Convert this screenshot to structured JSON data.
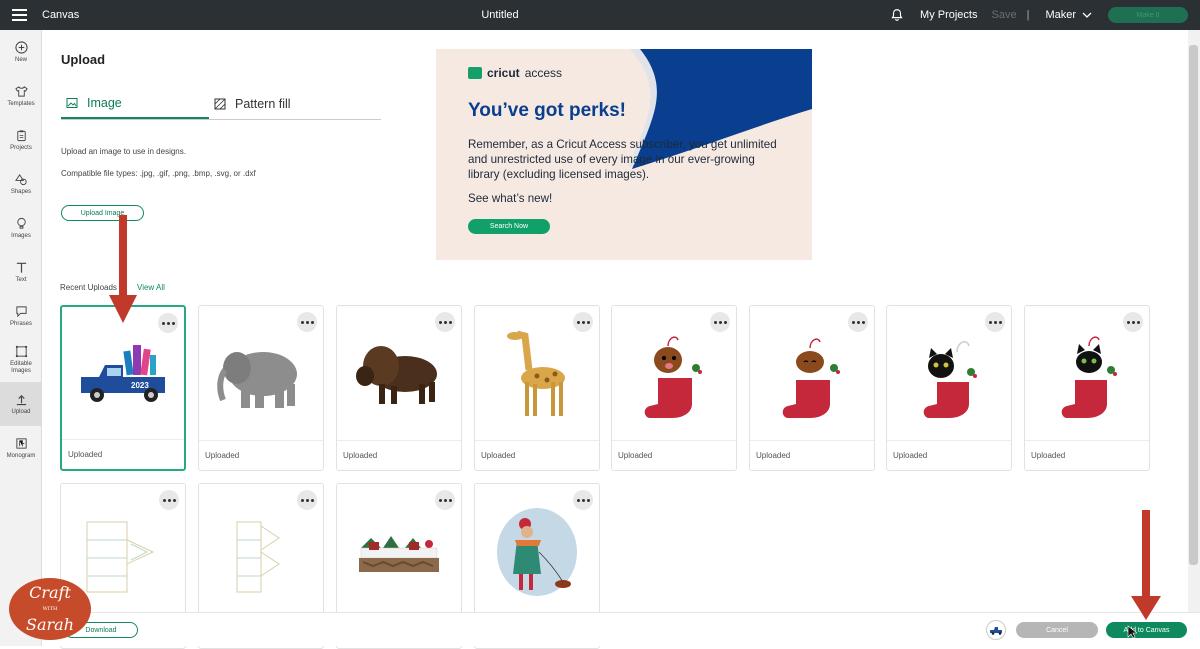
{
  "topbar": {
    "app_name": "Canvas",
    "doc_title": "Untitled",
    "my_projects": "My Projects",
    "save": "Save",
    "separator": "|",
    "machine": "Maker",
    "make_it": "Make It"
  },
  "leftnav": {
    "items": [
      {
        "label": "New",
        "icon": "plus-circle-icon"
      },
      {
        "label": "Templates",
        "icon": "shirt-icon"
      },
      {
        "label": "Projects",
        "icon": "clipboard-icon"
      },
      {
        "label": "Shapes",
        "icon": "shapes-icon"
      },
      {
        "label": "Images",
        "icon": "bulb-icon"
      },
      {
        "label": "Text",
        "icon": "text-icon"
      },
      {
        "label": "Phrases",
        "icon": "speech-bubble-icon"
      },
      {
        "label": "Editable Images",
        "icon": "editable-images-icon"
      },
      {
        "label": "Upload",
        "icon": "upload-icon"
      },
      {
        "label": "Monogram",
        "icon": "monogram-icon"
      }
    ]
  },
  "panel": {
    "title": "Upload",
    "tabs": [
      {
        "label": "Image",
        "active": true
      },
      {
        "label": "Pattern fill",
        "active": false
      }
    ],
    "desc": "Upload an image to use in designs.",
    "file_types": "Compatible file types: .jpg, .gif, .png, .bmp, .svg, or .dxf",
    "upload_button": "Upload Image"
  },
  "banner": {
    "brand": "cricut",
    "brand_suffix": "access",
    "heading": "You’ve got perks!",
    "body": "Remember, as a Cricut Access subscriber, you get unlimited and unrestricted use of every image in our ever-growing library (excluding licensed images).",
    "sub": "See what’s new!",
    "button": "Search Now"
  },
  "recent": {
    "label": "Recent Uploads",
    "view_all": "View All",
    "cards": [
      {
        "caption": "Uploaded",
        "image": "blue-truck-2023",
        "selected": true
      },
      {
        "caption": "Uploaded",
        "image": "elephant"
      },
      {
        "caption": "Uploaded",
        "image": "bison"
      },
      {
        "caption": "Uploaded",
        "image": "giraffe"
      },
      {
        "caption": "Uploaded",
        "image": "dog-stocking"
      },
      {
        "caption": "Uploaded",
        "image": "dog-stocking-2"
      },
      {
        "caption": "Uploaded",
        "image": "black-cat-stocking"
      },
      {
        "caption": "Uploaded",
        "image": "black-cat-stocking-2"
      },
      {
        "caption": "",
        "image": "box-template"
      },
      {
        "caption": "",
        "image": "box-template-2"
      },
      {
        "caption": "",
        "image": "winter-village"
      },
      {
        "caption": "",
        "image": "girl-walking-dog"
      }
    ]
  },
  "bottom": {
    "download": "Download",
    "cancel": "Cancel",
    "add_to_canvas": "Add to Canvas"
  },
  "watermark": {
    "line1": "Craft",
    "with": "WITH",
    "line2": "Sarah"
  },
  "colors": {
    "accent": "#0f8a5e",
    "topbar": "#2b3034",
    "banner_blue": "#0a3e8f",
    "arrow": "#c0392b"
  }
}
